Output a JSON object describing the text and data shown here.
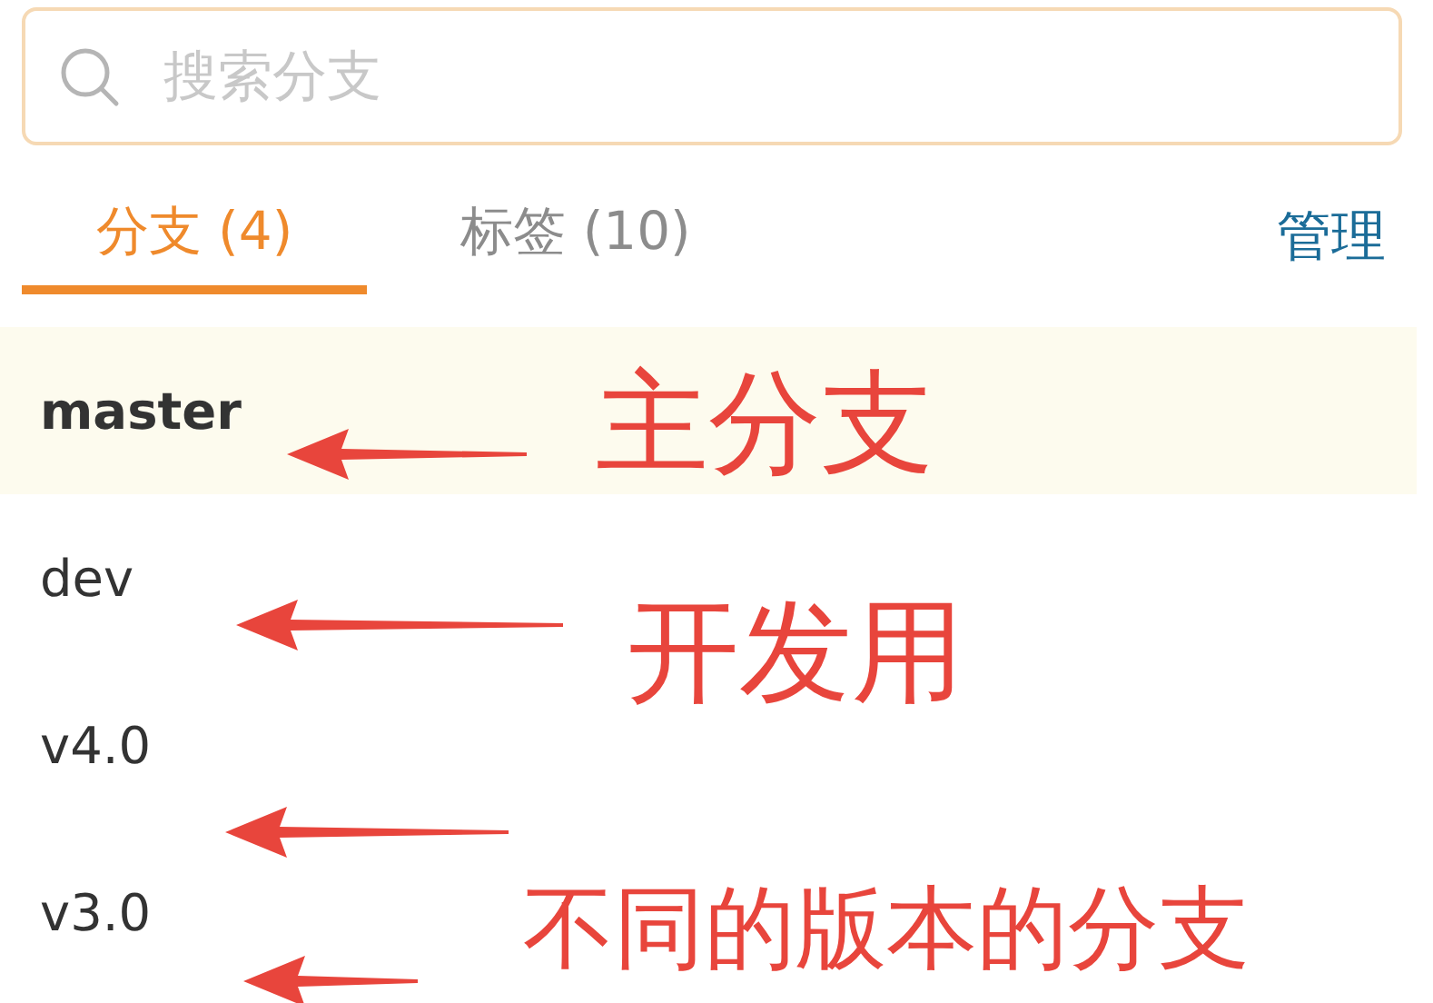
{
  "search": {
    "placeholder": "搜索分支"
  },
  "tabs": [
    {
      "label": "分支 (4)",
      "selected": true
    },
    {
      "label": "标签 (10)",
      "selected": false
    }
  ],
  "manage_link": "管理",
  "branches": [
    {
      "name": "master",
      "selected": true
    },
    {
      "name": "dev",
      "selected": false
    },
    {
      "name": "v4.0",
      "selected": false
    },
    {
      "name": "v3.0",
      "selected": false
    }
  ],
  "annotations": [
    {
      "text": "主分支"
    },
    {
      "text": "开发用"
    },
    {
      "text": "不同的版本的分支"
    }
  ]
}
